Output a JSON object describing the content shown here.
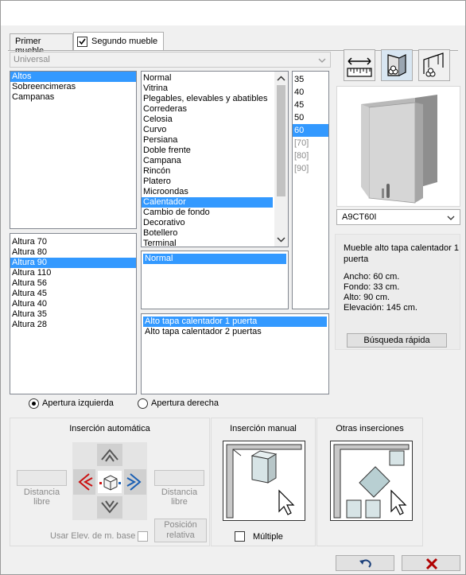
{
  "tabs": [
    {
      "label": "Primer mueble"
    },
    {
      "label": "Segundo mueble",
      "checked": true
    }
  ],
  "catalog_combo": {
    "value": "Universal"
  },
  "categories": [
    "Altos",
    "Sobreencimeras",
    "Campanas"
  ],
  "types": [
    "Normal",
    "Vitrina",
    "Plegables, elevables y abatibles",
    "Correderas",
    "Celosia",
    "Curvo",
    "Persiana",
    "Doble frente",
    "Campana",
    "Rincón",
    "Platero",
    "Microondas",
    "Calentador",
    "Cambio de fondo",
    "Decorativo",
    "Botellero",
    "Terminal"
  ],
  "widths": [
    "35",
    "40",
    "45",
    "50",
    "60",
    "[70]",
    "[80]",
    "[90]"
  ],
  "heights": [
    "Altura 70",
    "Altura 80",
    "Altura 90",
    "Altura 110",
    "Altura 56",
    "Altura 45",
    "Altura 40",
    "Altura 35",
    "Altura 28"
  ],
  "subtypes": [
    "Normal"
  ],
  "models": [
    "Alto tapa calentador 1 puerta",
    "Alto tapa calentador 2 puertas"
  ],
  "preview": {
    "code": "A9CT60I",
    "description": "Mueble alto tapa calentador 1 puerta",
    "ancho": "Ancho: 60 cm.",
    "fondo": "Fondo: 33 cm.",
    "alto": "Alto: 90 cm.",
    "elevacion": "Elevación: 145 cm.",
    "quick_search": "Búsqueda rápida"
  },
  "opening": {
    "left": "Apertura izquierda",
    "right": "Apertura derecha",
    "selected": "left"
  },
  "auto_insertion": {
    "title": "Inserción automática",
    "distance_left": "Distancia libre",
    "distance_right": "Distancia libre",
    "use_elev": "Usar Elev. de m. base",
    "relative": "Posición relativa"
  },
  "manual_insertion": {
    "title": "Inserción manual",
    "multiple": "Múltiple"
  },
  "other_insertions": {
    "title": "Otras inserciones"
  },
  "colors": {
    "selection": "#3399ff",
    "accent_red": "#cc1111",
    "accent_blue": "#1a5fb4"
  }
}
